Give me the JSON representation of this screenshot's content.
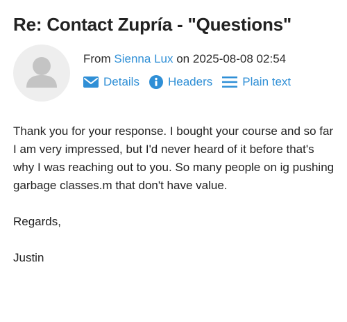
{
  "message": {
    "subject": "Re: Contact Zupría - \"Questions\"",
    "from_prefix": "From",
    "sender_name": "Sienna Lux",
    "date_prefix": "on",
    "date": "2025-08-08 02:54",
    "actions": [
      {
        "label": "Details",
        "icon": "envelope-icon"
      },
      {
        "label": "Headers",
        "icon": "info-icon"
      },
      {
        "label": "Plain text",
        "icon": "lines-icon"
      }
    ],
    "body": {
      "paragraph1": "Thank you for your response.  I bought your course and so far I am very impressed, but I'd never heard of it before that's why I was reaching out to you.  So many people on ig pushing garbage classes.m that don't have value.",
      "closing": "Regards,",
      "signature": "Justin"
    }
  },
  "colors": {
    "link": "#2f8fd6",
    "text": "#222222",
    "avatar_bg": "#eeeeee",
    "avatar_fg": "#c4c4c4"
  }
}
